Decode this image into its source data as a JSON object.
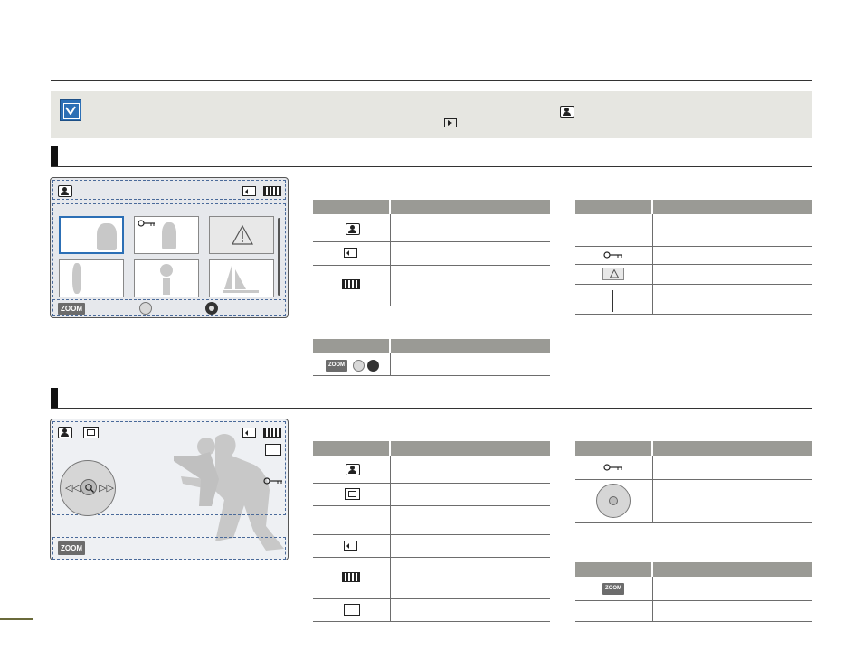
{
  "header": {},
  "note": {
    "icon": "checkmark-note-icon",
    "inline_icons": [
      "photo-playback-mode-icon",
      "play-button-icon"
    ]
  },
  "sections": [
    {
      "id": "thumbnail-view",
      "screen": {
        "top_icons": [
          "photo-playback-mode-icon",
          "memory-card-icon",
          "battery-icon"
        ],
        "thumbnails": [
          "kids-photo",
          "protected-photo",
          "error-photo",
          "soccer-photo",
          "plant-photo",
          "sailboat-photo"
        ],
        "bottom_bar": {
          "zoom_label": "ZOOM",
          "icons": [
            "nav-joystick-icon",
            "ok-button-icon"
          ]
        }
      },
      "table1_icons": [
        "photo-playback-mode-icon",
        "memory-card-icon",
        "battery-icon"
      ],
      "table2_icons": [
        "zoom-lever-icon",
        "nav-joystick-icon",
        "ok-button-icon"
      ],
      "table3_icons": [
        "",
        "protect-key-icon",
        "warning-icon",
        "scroll-bar-icon"
      ]
    },
    {
      "id": "single-view",
      "screen": {
        "top_icons": [
          "photo-playback-mode-icon",
          "slideshow-icon",
          "memory-card-icon",
          "battery-icon",
          "photo-size-icon",
          "protect-key-icon"
        ],
        "nav_icons": [
          "rewind-icon",
          "magnify-icon",
          "fast-forward-icon"
        ],
        "zoom_label": "ZOOM"
      },
      "table1_icons": [
        "photo-playback-mode-icon",
        "slideshow-icon",
        "",
        "memory-card-icon",
        "battery-icon",
        "photo-size-icon"
      ],
      "table2_icons": [
        "protect-key-icon",
        "nav-joystick-icon"
      ],
      "table3_label": "ZOOM"
    }
  ],
  "colors": {
    "accent": "#2c6fb5",
    "note_bg": "#e6e6e1",
    "table_header": "#9a9a95"
  }
}
